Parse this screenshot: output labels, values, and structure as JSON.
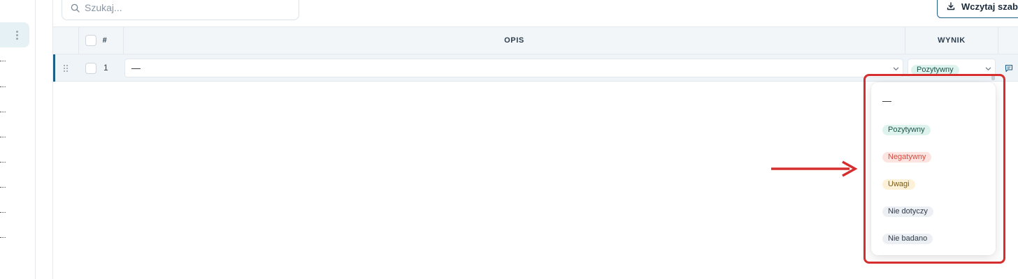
{
  "search": {
    "placeholder": "Szukaj..."
  },
  "toolbar": {
    "load_template_label": "Wczytaj szabl"
  },
  "table": {
    "columns": {
      "number": "#",
      "opis": "OPIS",
      "wynik": "WYNIK"
    },
    "rows": [
      {
        "number": "1",
        "opis": "—",
        "wynik": "Pozytywny"
      }
    ]
  },
  "wynik_dropdown": {
    "options": [
      {
        "label": "—",
        "style": "none"
      },
      {
        "label": "Pozytywny",
        "style": "positive",
        "color": "#dff3ee"
      },
      {
        "label": "Negatywny",
        "style": "negative",
        "color": "#fde4e1"
      },
      {
        "label": "Uwagi",
        "style": "note",
        "color": "#fdf2d8"
      },
      {
        "label": "Nie dotyczy",
        "style": "neutral",
        "color": "#eceff3"
      },
      {
        "label": "Nie badano",
        "style": "neutral",
        "color": "#eceff3"
      }
    ]
  },
  "colors": {
    "accent": "#1e5f86",
    "annotation": "#d62e2e"
  }
}
